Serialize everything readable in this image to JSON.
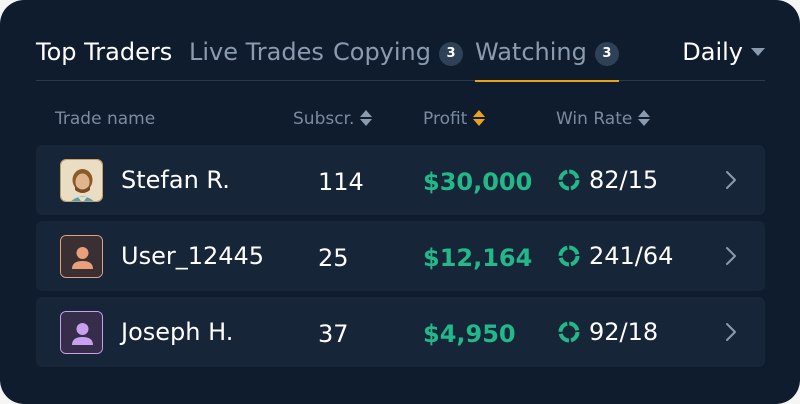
{
  "tabs": [
    {
      "label": "Top Traders"
    },
    {
      "label": "Live Trades"
    },
    {
      "label": "Copying",
      "badge": "3"
    },
    {
      "label": "Watching",
      "badge": "3"
    }
  ],
  "period": {
    "label": "Daily"
  },
  "columns": {
    "name": "Trade name",
    "subs": "Subscr.",
    "profit": "Profit",
    "winrate": "Win Rate"
  },
  "rows": [
    {
      "name": "Stefan R.",
      "subs": "114",
      "profit": "$30,000",
      "winrate": "82/15",
      "avatar": "photo-avatar"
    },
    {
      "name": "User_12445",
      "subs": "25",
      "profit": "$12,164",
      "winrate": "241/64",
      "avatar": "user-icon"
    },
    {
      "name": "Joseph H.",
      "subs": "37",
      "profit": "$4,950",
      "winrate": "92/18",
      "avatar": "user-icon"
    }
  ],
  "colors": {
    "background": "#0f1c2e",
    "row": "#172538",
    "accent": "#e8a317",
    "profit": "#22b889",
    "avatar_orange": "#e8a07a",
    "avatar_purple": "#c9a0f0"
  }
}
